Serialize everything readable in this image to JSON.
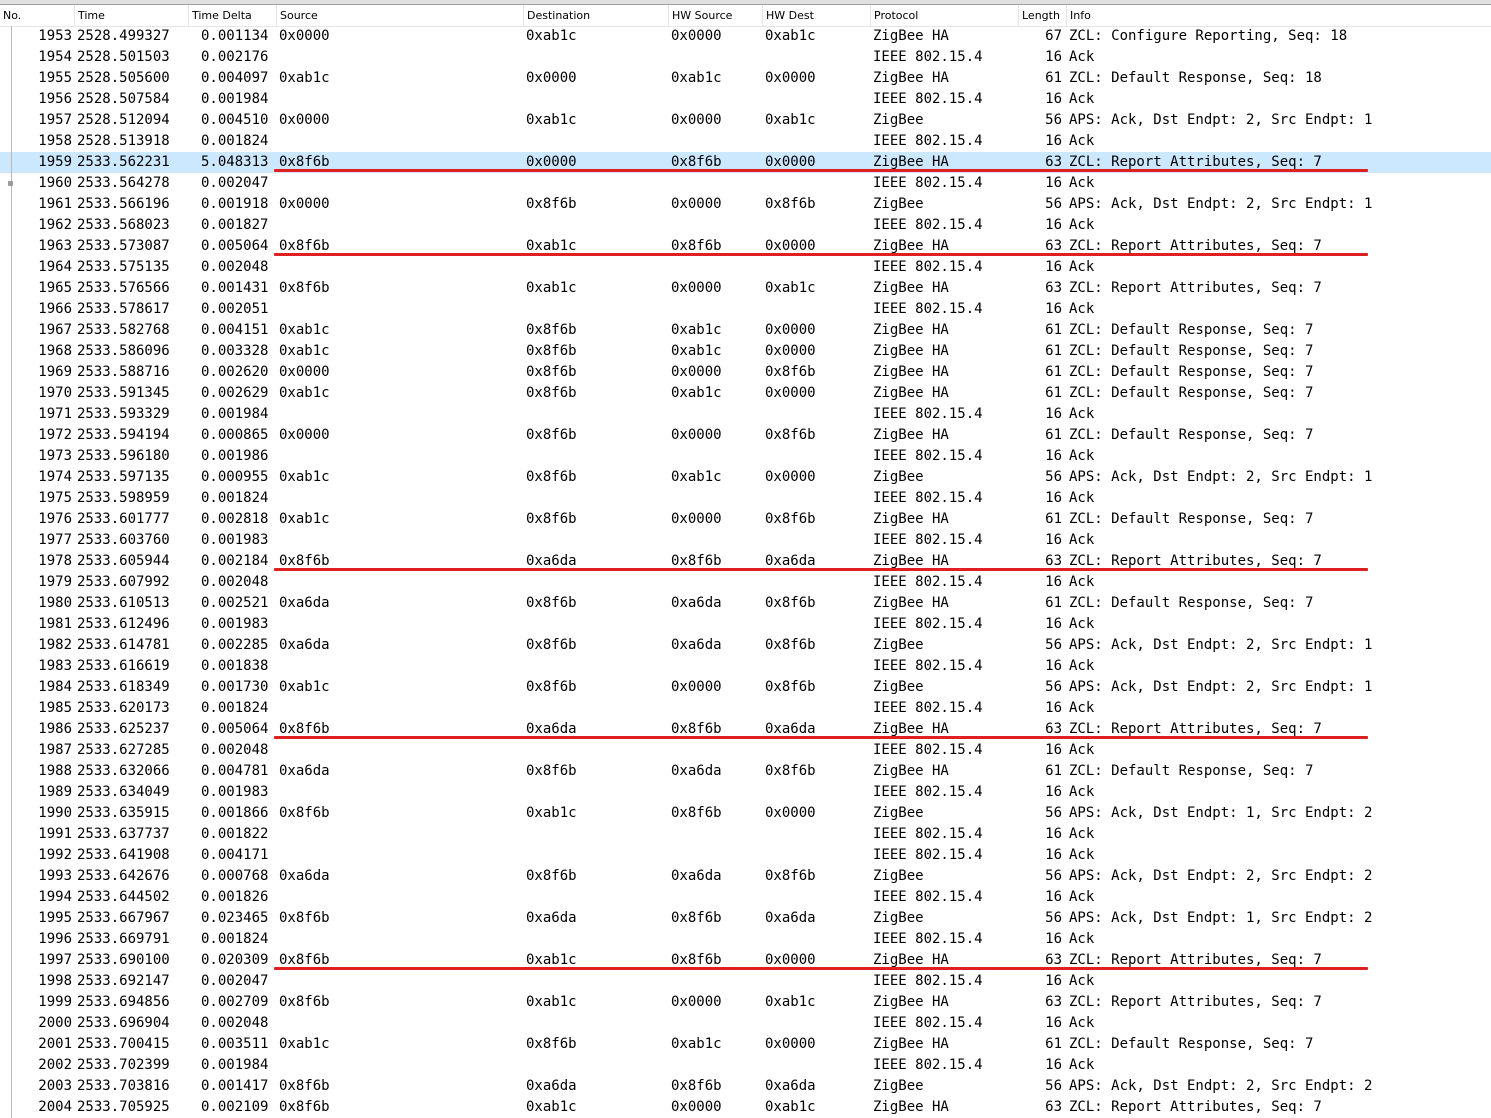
{
  "columns": [
    "No.",
    "Time",
    "Time Delta",
    "Source",
    "Destination",
    "HW Source",
    "HW Dest",
    "Protocol",
    "Length",
    "Info"
  ],
  "selected_no": "1959",
  "underlined_rows": [
    "1959",
    "1963",
    "1978",
    "1986",
    "1997"
  ],
  "colors": {
    "selection": "#cce8ff",
    "underline": "#e02020"
  },
  "packets": [
    {
      "no": "1953",
      "time": "2528.499327",
      "delta": "0.001134",
      "src": "0x0000",
      "dst": "0xab1c",
      "hw_src": "0x0000",
      "hw_dst": "0xab1c",
      "proto": "ZigBee HA",
      "len": "67",
      "info": "ZCL: Configure Reporting, Seq: 18"
    },
    {
      "no": "1954",
      "time": "2528.501503",
      "delta": "0.002176",
      "src": "",
      "dst": "",
      "hw_src": "",
      "hw_dst": "",
      "proto": "IEEE 802.15.4",
      "len": "16",
      "info": "Ack"
    },
    {
      "no": "1955",
      "time": "2528.505600",
      "delta": "0.004097",
      "src": "0xab1c",
      "dst": "0x0000",
      "hw_src": "0xab1c",
      "hw_dst": "0x0000",
      "proto": "ZigBee HA",
      "len": "61",
      "info": "ZCL: Default Response, Seq: 18"
    },
    {
      "no": "1956",
      "time": "2528.507584",
      "delta": "0.001984",
      "src": "",
      "dst": "",
      "hw_src": "",
      "hw_dst": "",
      "proto": "IEEE 802.15.4",
      "len": "16",
      "info": "Ack"
    },
    {
      "no": "1957",
      "time": "2528.512094",
      "delta": "0.004510",
      "src": "0x0000",
      "dst": "0xab1c",
      "hw_src": "0x0000",
      "hw_dst": "0xab1c",
      "proto": "ZigBee",
      "len": "56",
      "info": "APS: Ack, Dst Endpt: 2, Src Endpt: 1"
    },
    {
      "no": "1958",
      "time": "2528.513918",
      "delta": "0.001824",
      "src": "",
      "dst": "",
      "hw_src": "",
      "hw_dst": "",
      "proto": "IEEE 802.15.4",
      "len": "16",
      "info": "Ack"
    },
    {
      "no": "1959",
      "time": "2533.562231",
      "delta": "5.048313",
      "src": "0x8f6b",
      "dst": "0x0000",
      "hw_src": "0x8f6b",
      "hw_dst": "0x0000",
      "proto": "ZigBee HA",
      "len": "63",
      "info": "ZCL: Report Attributes, Seq: 7"
    },
    {
      "no": "1960",
      "time": "2533.564278",
      "delta": "0.002047",
      "src": "",
      "dst": "",
      "hw_src": "",
      "hw_dst": "",
      "proto": "IEEE 802.15.4",
      "len": "16",
      "info": "Ack"
    },
    {
      "no": "1961",
      "time": "2533.566196",
      "delta": "0.001918",
      "src": "0x0000",
      "dst": "0x8f6b",
      "hw_src": "0x0000",
      "hw_dst": "0x8f6b",
      "proto": "ZigBee",
      "len": "56",
      "info": "APS: Ack, Dst Endpt: 2, Src Endpt: 1"
    },
    {
      "no": "1962",
      "time": "2533.568023",
      "delta": "0.001827",
      "src": "",
      "dst": "",
      "hw_src": "",
      "hw_dst": "",
      "proto": "IEEE 802.15.4",
      "len": "16",
      "info": "Ack"
    },
    {
      "no": "1963",
      "time": "2533.573087",
      "delta": "0.005064",
      "src": "0x8f6b",
      "dst": "0xab1c",
      "hw_src": "0x8f6b",
      "hw_dst": "0x0000",
      "proto": "ZigBee HA",
      "len": "63",
      "info": "ZCL: Report Attributes, Seq: 7"
    },
    {
      "no": "1964",
      "time": "2533.575135",
      "delta": "0.002048",
      "src": "",
      "dst": "",
      "hw_src": "",
      "hw_dst": "",
      "proto": "IEEE 802.15.4",
      "len": "16",
      "info": "Ack"
    },
    {
      "no": "1965",
      "time": "2533.576566",
      "delta": "0.001431",
      "src": "0x8f6b",
      "dst": "0xab1c",
      "hw_src": "0x0000",
      "hw_dst": "0xab1c",
      "proto": "ZigBee HA",
      "len": "63",
      "info": "ZCL: Report Attributes, Seq: 7"
    },
    {
      "no": "1966",
      "time": "2533.578617",
      "delta": "0.002051",
      "src": "",
      "dst": "",
      "hw_src": "",
      "hw_dst": "",
      "proto": "IEEE 802.15.4",
      "len": "16",
      "info": "Ack"
    },
    {
      "no": "1967",
      "time": "2533.582768",
      "delta": "0.004151",
      "src": "0xab1c",
      "dst": "0x8f6b",
      "hw_src": "0xab1c",
      "hw_dst": "0x0000",
      "proto": "ZigBee HA",
      "len": "61",
      "info": "ZCL: Default Response, Seq: 7"
    },
    {
      "no": "1968",
      "time": "2533.586096",
      "delta": "0.003328",
      "src": "0xab1c",
      "dst": "0x8f6b",
      "hw_src": "0xab1c",
      "hw_dst": "0x0000",
      "proto": "ZigBee HA",
      "len": "61",
      "info": "ZCL: Default Response, Seq: 7"
    },
    {
      "no": "1969",
      "time": "2533.588716",
      "delta": "0.002620",
      "src": "0x0000",
      "dst": "0x8f6b",
      "hw_src": "0x0000",
      "hw_dst": "0x8f6b",
      "proto": "ZigBee HA",
      "len": "61",
      "info": "ZCL: Default Response, Seq: 7"
    },
    {
      "no": "1970",
      "time": "2533.591345",
      "delta": "0.002629",
      "src": "0xab1c",
      "dst": "0x8f6b",
      "hw_src": "0xab1c",
      "hw_dst": "0x0000",
      "proto": "ZigBee HA",
      "len": "61",
      "info": "ZCL: Default Response, Seq: 7"
    },
    {
      "no": "1971",
      "time": "2533.593329",
      "delta": "0.001984",
      "src": "",
      "dst": "",
      "hw_src": "",
      "hw_dst": "",
      "proto": "IEEE 802.15.4",
      "len": "16",
      "info": "Ack"
    },
    {
      "no": "1972",
      "time": "2533.594194",
      "delta": "0.000865",
      "src": "0x0000",
      "dst": "0x8f6b",
      "hw_src": "0x0000",
      "hw_dst": "0x8f6b",
      "proto": "ZigBee HA",
      "len": "61",
      "info": "ZCL: Default Response, Seq: 7"
    },
    {
      "no": "1973",
      "time": "2533.596180",
      "delta": "0.001986",
      "src": "",
      "dst": "",
      "hw_src": "",
      "hw_dst": "",
      "proto": "IEEE 802.15.4",
      "len": "16",
      "info": "Ack"
    },
    {
      "no": "1974",
      "time": "2533.597135",
      "delta": "0.000955",
      "src": "0xab1c",
      "dst": "0x8f6b",
      "hw_src": "0xab1c",
      "hw_dst": "0x0000",
      "proto": "ZigBee",
      "len": "56",
      "info": "APS: Ack, Dst Endpt: 2, Src Endpt: 1"
    },
    {
      "no": "1975",
      "time": "2533.598959",
      "delta": "0.001824",
      "src": "",
      "dst": "",
      "hw_src": "",
      "hw_dst": "",
      "proto": "IEEE 802.15.4",
      "len": "16",
      "info": "Ack"
    },
    {
      "no": "1976",
      "time": "2533.601777",
      "delta": "0.002818",
      "src": "0xab1c",
      "dst": "0x8f6b",
      "hw_src": "0x0000",
      "hw_dst": "0x8f6b",
      "proto": "ZigBee HA",
      "len": "61",
      "info": "ZCL: Default Response, Seq: 7"
    },
    {
      "no": "1977",
      "time": "2533.603760",
      "delta": "0.001983",
      "src": "",
      "dst": "",
      "hw_src": "",
      "hw_dst": "",
      "proto": "IEEE 802.15.4",
      "len": "16",
      "info": "Ack"
    },
    {
      "no": "1978",
      "time": "2533.605944",
      "delta": "0.002184",
      "src": "0x8f6b",
      "dst": "0xa6da",
      "hw_src": "0x8f6b",
      "hw_dst": "0xa6da",
      "proto": "ZigBee HA",
      "len": "63",
      "info": "ZCL: Report Attributes, Seq: 7"
    },
    {
      "no": "1979",
      "time": "2533.607992",
      "delta": "0.002048",
      "src": "",
      "dst": "",
      "hw_src": "",
      "hw_dst": "",
      "proto": "IEEE 802.15.4",
      "len": "16",
      "info": "Ack"
    },
    {
      "no": "1980",
      "time": "2533.610513",
      "delta": "0.002521",
      "src": "0xa6da",
      "dst": "0x8f6b",
      "hw_src": "0xa6da",
      "hw_dst": "0x8f6b",
      "proto": "ZigBee HA",
      "len": "61",
      "info": "ZCL: Default Response, Seq: 7"
    },
    {
      "no": "1981",
      "time": "2533.612496",
      "delta": "0.001983",
      "src": "",
      "dst": "",
      "hw_src": "",
      "hw_dst": "",
      "proto": "IEEE 802.15.4",
      "len": "16",
      "info": "Ack"
    },
    {
      "no": "1982",
      "time": "2533.614781",
      "delta": "0.002285",
      "src": "0xa6da",
      "dst": "0x8f6b",
      "hw_src": "0xa6da",
      "hw_dst": "0x8f6b",
      "proto": "ZigBee",
      "len": "56",
      "info": "APS: Ack, Dst Endpt: 2, Src Endpt: 1"
    },
    {
      "no": "1983",
      "time": "2533.616619",
      "delta": "0.001838",
      "src": "",
      "dst": "",
      "hw_src": "",
      "hw_dst": "",
      "proto": "IEEE 802.15.4",
      "len": "16",
      "info": "Ack"
    },
    {
      "no": "1984",
      "time": "2533.618349",
      "delta": "0.001730",
      "src": "0xab1c",
      "dst": "0x8f6b",
      "hw_src": "0x0000",
      "hw_dst": "0x8f6b",
      "proto": "ZigBee",
      "len": "56",
      "info": "APS: Ack, Dst Endpt: 2, Src Endpt: 1"
    },
    {
      "no": "1985",
      "time": "2533.620173",
      "delta": "0.001824",
      "src": "",
      "dst": "",
      "hw_src": "",
      "hw_dst": "",
      "proto": "IEEE 802.15.4",
      "len": "16",
      "info": "Ack"
    },
    {
      "no": "1986",
      "time": "2533.625237",
      "delta": "0.005064",
      "src": "0x8f6b",
      "dst": "0xa6da",
      "hw_src": "0x8f6b",
      "hw_dst": "0xa6da",
      "proto": "ZigBee HA",
      "len": "63",
      "info": "ZCL: Report Attributes, Seq: 7"
    },
    {
      "no": "1987",
      "time": "2533.627285",
      "delta": "0.002048",
      "src": "",
      "dst": "",
      "hw_src": "",
      "hw_dst": "",
      "proto": "IEEE 802.15.4",
      "len": "16",
      "info": "Ack"
    },
    {
      "no": "1988",
      "time": "2533.632066",
      "delta": "0.004781",
      "src": "0xa6da",
      "dst": "0x8f6b",
      "hw_src": "0xa6da",
      "hw_dst": "0x8f6b",
      "proto": "ZigBee HA",
      "len": "61",
      "info": "ZCL: Default Response, Seq: 7"
    },
    {
      "no": "1989",
      "time": "2533.634049",
      "delta": "0.001983",
      "src": "",
      "dst": "",
      "hw_src": "",
      "hw_dst": "",
      "proto": "IEEE 802.15.4",
      "len": "16",
      "info": "Ack"
    },
    {
      "no": "1990",
      "time": "2533.635915",
      "delta": "0.001866",
      "src": "0x8f6b",
      "dst": "0xab1c",
      "hw_src": "0x8f6b",
      "hw_dst": "0x0000",
      "proto": "ZigBee",
      "len": "56",
      "info": "APS: Ack, Dst Endpt: 1, Src Endpt: 2"
    },
    {
      "no": "1991",
      "time": "2533.637737",
      "delta": "0.001822",
      "src": "",
      "dst": "",
      "hw_src": "",
      "hw_dst": "",
      "proto": "IEEE 802.15.4",
      "len": "16",
      "info": "Ack"
    },
    {
      "no": "1992",
      "time": "2533.641908",
      "delta": "0.004171",
      "src": "",
      "dst": "",
      "hw_src": "",
      "hw_dst": "",
      "proto": "IEEE 802.15.4",
      "len": "16",
      "info": "Ack"
    },
    {
      "no": "1993",
      "time": "2533.642676",
      "delta": "0.000768",
      "src": "0xa6da",
      "dst": "0x8f6b",
      "hw_src": "0xa6da",
      "hw_dst": "0x8f6b",
      "proto": "ZigBee",
      "len": "56",
      "info": "APS: Ack, Dst Endpt: 2, Src Endpt: 2"
    },
    {
      "no": "1994",
      "time": "2533.644502",
      "delta": "0.001826",
      "src": "",
      "dst": "",
      "hw_src": "",
      "hw_dst": "",
      "proto": "IEEE 802.15.4",
      "len": "16",
      "info": "Ack"
    },
    {
      "no": "1995",
      "time": "2533.667967",
      "delta": "0.023465",
      "src": "0x8f6b",
      "dst": "0xa6da",
      "hw_src": "0x8f6b",
      "hw_dst": "0xa6da",
      "proto": "ZigBee",
      "len": "56",
      "info": "APS: Ack, Dst Endpt: 1, Src Endpt: 2"
    },
    {
      "no": "1996",
      "time": "2533.669791",
      "delta": "0.001824",
      "src": "",
      "dst": "",
      "hw_src": "",
      "hw_dst": "",
      "proto": "IEEE 802.15.4",
      "len": "16",
      "info": "Ack"
    },
    {
      "no": "1997",
      "time": "2533.690100",
      "delta": "0.020309",
      "src": "0x8f6b",
      "dst": "0xab1c",
      "hw_src": "0x8f6b",
      "hw_dst": "0x0000",
      "proto": "ZigBee HA",
      "len": "63",
      "info": "ZCL: Report Attributes, Seq: 7"
    },
    {
      "no": "1998",
      "time": "2533.692147",
      "delta": "0.002047",
      "src": "",
      "dst": "",
      "hw_src": "",
      "hw_dst": "",
      "proto": "IEEE 802.15.4",
      "len": "16",
      "info": "Ack"
    },
    {
      "no": "1999",
      "time": "2533.694856",
      "delta": "0.002709",
      "src": "0x8f6b",
      "dst": "0xab1c",
      "hw_src": "0x0000",
      "hw_dst": "0xab1c",
      "proto": "ZigBee HA",
      "len": "63",
      "info": "ZCL: Report Attributes, Seq: 7"
    },
    {
      "no": "2000",
      "time": "2533.696904",
      "delta": "0.002048",
      "src": "",
      "dst": "",
      "hw_src": "",
      "hw_dst": "",
      "proto": "IEEE 802.15.4",
      "len": "16",
      "info": "Ack"
    },
    {
      "no": "2001",
      "time": "2533.700415",
      "delta": "0.003511",
      "src": "0xab1c",
      "dst": "0x8f6b",
      "hw_src": "0xab1c",
      "hw_dst": "0x0000",
      "proto": "ZigBee HA",
      "len": "61",
      "info": "ZCL: Default Response, Seq: 7"
    },
    {
      "no": "2002",
      "time": "2533.702399",
      "delta": "0.001984",
      "src": "",
      "dst": "",
      "hw_src": "",
      "hw_dst": "",
      "proto": "IEEE 802.15.4",
      "len": "16",
      "info": "Ack"
    },
    {
      "no": "2003",
      "time": "2533.703816",
      "delta": "0.001417",
      "src": "0x8f6b",
      "dst": "0xa6da",
      "hw_src": "0x8f6b",
      "hw_dst": "0xa6da",
      "proto": "ZigBee",
      "len": "56",
      "info": "APS: Ack, Dst Endpt: 2, Src Endpt: 2"
    },
    {
      "no": "2004",
      "time": "2533.705925",
      "delta": "0.002109",
      "src": "0x8f6b",
      "dst": "0xab1c",
      "hw_src": "0x0000",
      "hw_dst": "0xab1c",
      "proto": "ZigBee HA",
      "len": "63",
      "info": "ZCL: Report Attributes, Seq: 7"
    }
  ]
}
